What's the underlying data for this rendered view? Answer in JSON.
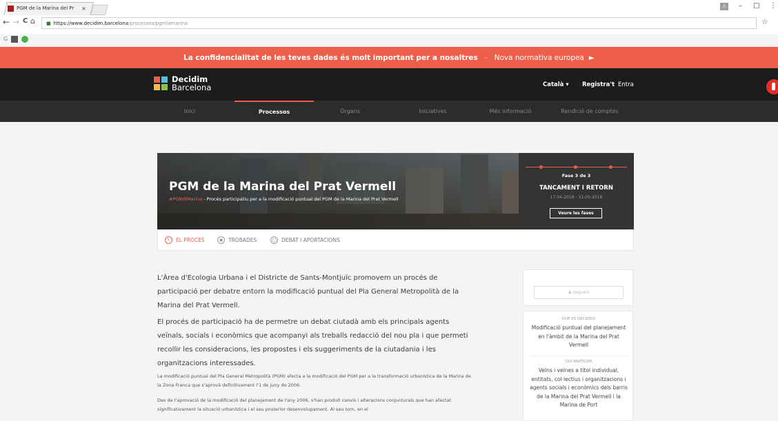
{
  "browser": {
    "tab_title": "PGM de la Marina del Pr",
    "tab_close": "×",
    "url_host": "https://www.decidim.barcelona",
    "url_path": "/processes/pgmlamarina",
    "back": "←",
    "forward": "→",
    "reload": "C",
    "home": "⌂",
    "star": "☆",
    "minimize": "–",
    "maximize": "□",
    "more": "⋮",
    "profile": "⚠"
  },
  "privacy_banner": {
    "message": "La confidencialitat de les teves dades és molt important per a nosaltres",
    "separator": "-",
    "link": "Nova normativa europea",
    "arrow": "►"
  },
  "header": {
    "logo_line1": "Decidim",
    "logo_line2": "Barcelona",
    "language": "Català ▾",
    "register": "Registra't",
    "separator": "·",
    "login": "Entra"
  },
  "menu": [
    "Inici",
    "Processos",
    "Òrgans",
    "Iniciatives",
    "Més informació",
    "Rendició de comptes"
  ],
  "hero": {
    "title": "PGM de la Marina del Prat Vermell",
    "hashtag": "#PGMdlMarina",
    "separator": " - ",
    "subtitle": "Procés participatiu per a la modificació puntual del PGM de la Marina del Prat Vermell"
  },
  "phase": {
    "count": "Fase 3 de 3",
    "name": "TANCAMENT I RETORN",
    "dates": "17-04-2018 - 31-05-2018",
    "button": "Veure les fases"
  },
  "tabs": [
    {
      "label": "EL PROCÉS",
      "icon": "process-icon",
      "glyph": "✎"
    },
    {
      "label": "TROBADES",
      "icon": "meetings-icon",
      "glyph": "◉"
    },
    {
      "label": "DEBAT I APORTACIONS",
      "icon": "debates-icon",
      "glyph": "◯"
    }
  ],
  "body": {
    "p1": "L'Àrea d'Ecologia Urbana i el Districte de Sants-Montjuïc promovem un procés de participació per debatre entorn la modificació puntual del Pla General Metropolità de la Marina del Prat Vermell.",
    "p2": "El procés de participació ha de permetre un debat ciutadà amb els principals agents veïnals, socials i econòmics que acompanyi als treballs redacció del nou pla i que permeti recollir les consideracions, les propostes i els suggeriments de la ciutadania i les organitzacions interessades.",
    "p3": "La modificació puntual del Pla General Metropolità (PGM) afecta a la modificació del PGM per a la transformació urbanística de la Marina de la Zona Franca que s'aprovà definitivament l'1 de juny de 2006.",
    "p4": "Des de l'aprovació de la modificació del planejament de l'any 2006, s'han produït canvis i alteracions conjunturals que han afectat significativament la situació urbanística i el seu posterior desenvolupament. Al seu torn, en el"
  },
  "sidebar": {
    "follow": "♟ Segueix",
    "what_heading": "QUÈ ES DECIDEIX",
    "what_text": "Modificació puntual del planejament en l'àmbit de la Marina del Prat Vermell",
    "who_heading": "QUI PARTICIPA",
    "who_text": "Veïns i veïnes a títol individual, entitats, col·lectius i organitzacions i agents socials i econòmics dels barris de la Marina del Prat Vermell i la Marina de Port"
  },
  "colors": {
    "accent": "#ee5f4b",
    "header_bg": "#1c1c1c",
    "menu_bg": "#2c2c2c",
    "phase_bg": "#343434"
  }
}
